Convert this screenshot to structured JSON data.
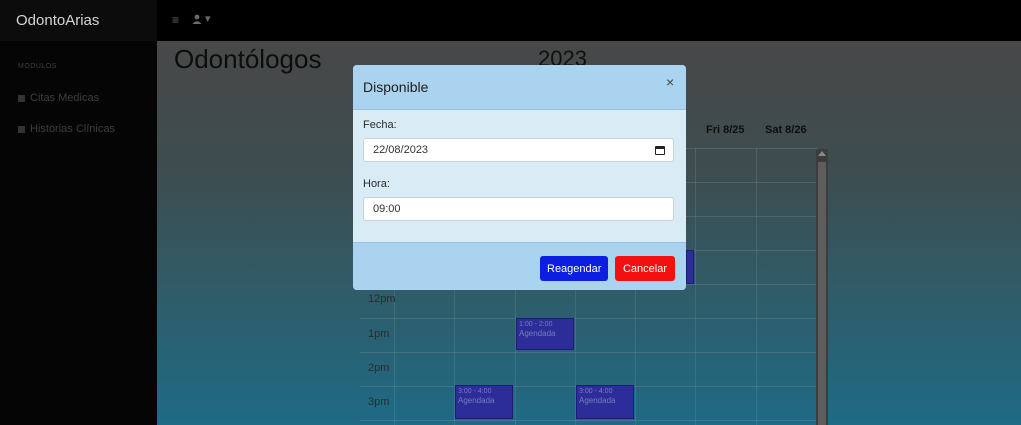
{
  "app": {
    "brand": "OdontoArias"
  },
  "topbar": {
    "menu_icon": "hamburger-icon",
    "user_icon": "user-icon",
    "user_caret": "▾"
  },
  "sidebar": {
    "heading": "MODULOS",
    "items": [
      {
        "label": "Citas Medicas",
        "icon": "square-icon"
      },
      {
        "label": "Historias Clínicas",
        "icon": "square-icon"
      }
    ]
  },
  "main": {
    "title": "Odontólogos",
    "calendar": {
      "title_fragment": "2023",
      "visible_day_headers": [
        "Fri 8/25",
        "Sat 8/26"
      ],
      "time_labels": [
        "12pm",
        "1pm",
        "2pm",
        "3pm"
      ],
      "events": [
        {
          "time": "1:00 - 2:00",
          "label": "Agendada"
        },
        {
          "time": "3:00 - 4:00",
          "label": "Agendada"
        },
        {
          "time": "3:00 - 4:00",
          "label": "Agendada"
        }
      ]
    }
  },
  "modal": {
    "title": "Disponible",
    "close_label": "×",
    "fecha_label": "Fecha:",
    "fecha_value": "22/08/2023",
    "hora_label": "Hora:",
    "hora_value": "09:00",
    "reagendar_label": "Reagendar",
    "cancelar_label": "Cancelar"
  },
  "colors": {
    "reagendar": "#0c1ee0",
    "cancelar": "#f21010",
    "modal_header": "#a9d3ef",
    "event": "#2d2d9a"
  }
}
